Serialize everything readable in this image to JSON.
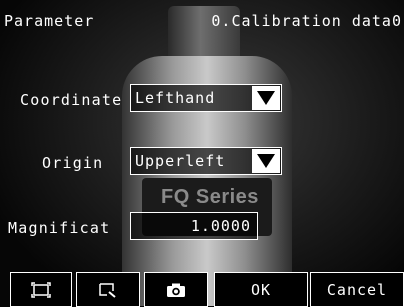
{
  "header": {
    "title": "Parameter",
    "context": "0.Calibration data0"
  },
  "form": {
    "coordinate": {
      "label": "Coordinate",
      "value": "Lefthand"
    },
    "origin": {
      "label": "Origin",
      "value": "Upperleft"
    },
    "magnification": {
      "label": "Magnificat",
      "value": "1.0000"
    }
  },
  "camera_view": {
    "label_text": "FQ Series"
  },
  "toolbar": {
    "fit_icon": "fit-screen-icon",
    "zoom_icon": "zoom-icon",
    "capture_icon": "camera-icon",
    "ok_label": "OK",
    "cancel_label": "Cancel"
  }
}
